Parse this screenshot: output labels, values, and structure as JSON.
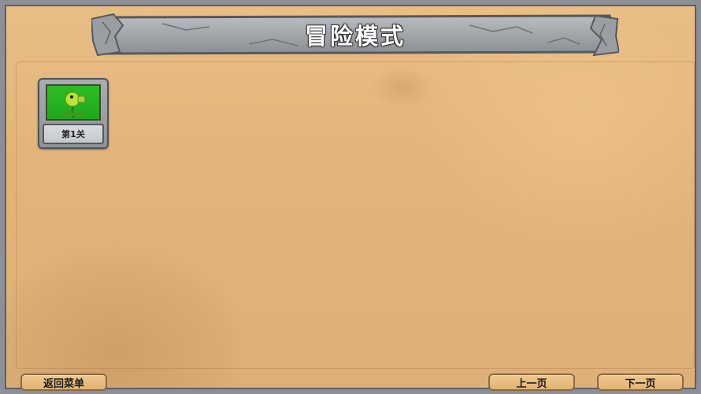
{
  "header": {
    "title": "冒险模式"
  },
  "levels": [
    {
      "label": "第1关",
      "thumbnail_icon": "peashooter-icon"
    }
  ],
  "footer": {
    "back_label": "返回菜单",
    "prev_label": "上一页",
    "next_label": "下一页"
  },
  "colors": {
    "parchment": "#e3b47a",
    "stone_frame": "#8c9096",
    "level_thumb_green": "#2ebd26",
    "button_fill": "#e9bf84"
  }
}
